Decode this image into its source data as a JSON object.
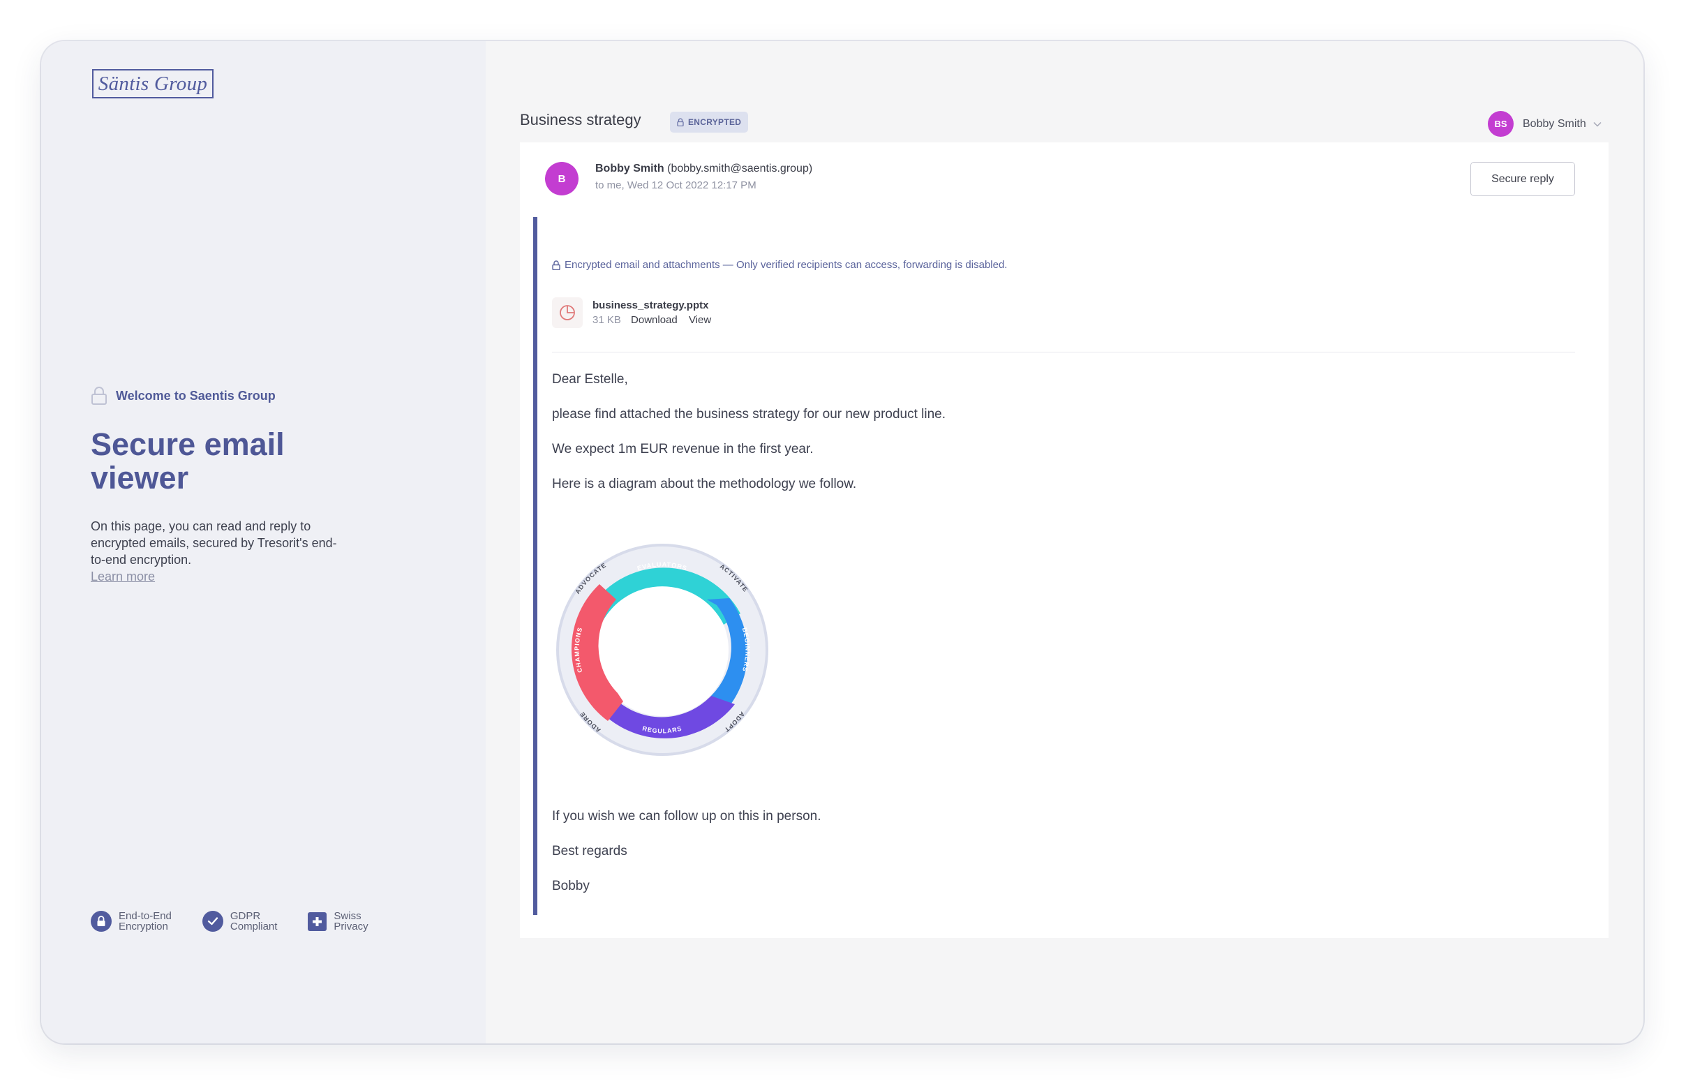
{
  "sidebar": {
    "logo_text": "Säntis Group",
    "welcome": "Welcome to Saentis Group",
    "title": "Secure email viewer",
    "description": "On this page, you can read and reply to encrypted emails, secured by Tresorit's end-to-end encryption.",
    "learn_more": "Learn more",
    "badges": [
      {
        "label": "End-to-End\nEncryption",
        "icon": "lock-icon"
      },
      {
        "label": "GDPR\nCompliant",
        "icon": "check-icon"
      },
      {
        "label": "Swiss\nPrivacy",
        "icon": "swiss-cross-icon"
      }
    ]
  },
  "header": {
    "subject": "Business strategy",
    "badge": "ENCRYPTED",
    "user_initials": "BS",
    "user_name": "Bobby Smith"
  },
  "email": {
    "sender_initial": "B",
    "sender_name": "Bobby Smith",
    "sender_email": "(bobby.smith@saentis.group)",
    "meta": "to me, Wed 12 Oct 2022 12:17 PM",
    "reply_label": "Secure reply",
    "notice": "Encrypted email and attachments — Only verified recipients can access, forwarding is disabled.",
    "attachment": {
      "name": "business_strategy.pptx",
      "size": "31 KB",
      "download": "Download",
      "view": "View"
    },
    "body": [
      "Dear Estelle,",
      "please find attached the business strategy for our new product line.",
      "We expect 1m EUR revenue in the first year.",
      "Here is a diagram about the methodology we follow."
    ],
    "body_after": [
      "If you wish we can follow up on this in person.",
      "Best regards",
      "Bobby"
    ]
  },
  "diagram": {
    "segments": [
      {
        "label": "EVALUATORS",
        "color": "#2fd2d6"
      },
      {
        "label": "BEGINNERS",
        "color": "#2d8ff0"
      },
      {
        "label": "REGULARS",
        "color": "#6f49e2"
      },
      {
        "label": "CHAMPIONS",
        "color": "#f3596c"
      }
    ],
    "transitions": [
      "ACTIVATE",
      "ADOPT",
      "ADORE",
      "ADVOCATE"
    ]
  },
  "colors": {
    "accent": "#515b9e",
    "avatar": "#c33dd1"
  }
}
